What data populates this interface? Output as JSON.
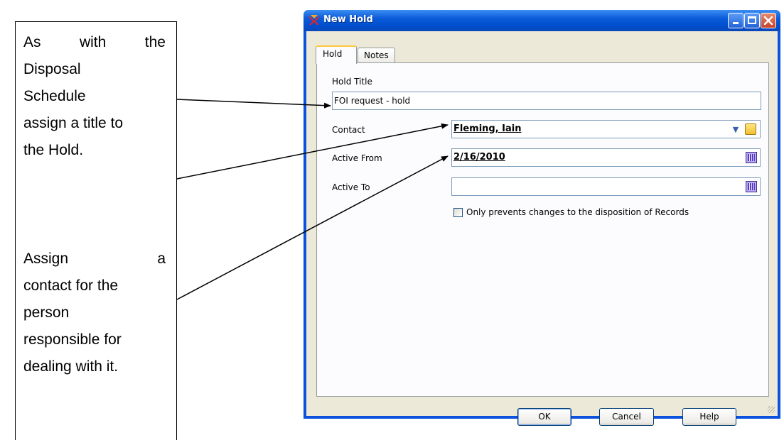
{
  "annotation": {
    "line1_words": [
      "As",
      "with",
      "the"
    ],
    "line2": "Disposal",
    "line3": "Schedule",
    "line4": "assign a title to",
    "line5": "the Hold.",
    "line6_words": [
      "Assign",
      "a"
    ],
    "line7": "contact for the",
    "line8": "person",
    "line9": "responsible for",
    "line10": "dealing with it."
  },
  "window": {
    "title": "New Hold",
    "icon": "app-logo-icon"
  },
  "tabs": [
    {
      "label": "Hold",
      "active": true
    },
    {
      "label": "Notes",
      "active": false
    }
  ],
  "form": {
    "hold_title_label": "Hold Title",
    "hold_title_value": "FOI request - hold",
    "contact_label": "Contact",
    "contact_value": "Fleming, Iain",
    "active_from_label": "Active From",
    "active_from_value": "2/16/2010",
    "active_to_label": "Active To",
    "active_to_value": "",
    "checkbox_label": "Only prevents changes to the disposition of Records",
    "checkbox_checked": false
  },
  "buttons": {
    "ok": "OK",
    "cancel": "Cancel",
    "help": "Help"
  },
  "colors": {
    "titlebar": "#0a52dd",
    "dialog_bg": "#ece9d8",
    "tab_highlight": "#ffc83c"
  }
}
